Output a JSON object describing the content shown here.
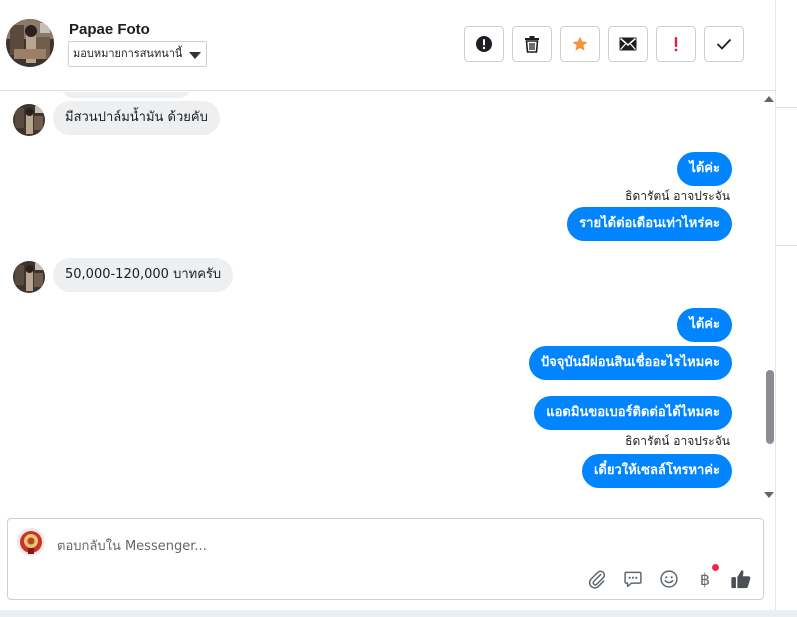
{
  "header": {
    "contact_name": "Papae Foto",
    "assign_label": "มอบหมายการสนทนานี้",
    "toolbar": [
      {
        "name": "report-button",
        "icon": "alert-circle-icon"
      },
      {
        "name": "delete-button",
        "icon": "trash-icon"
      },
      {
        "name": "star-button",
        "icon": "star-icon"
      },
      {
        "name": "mark-unread-button",
        "icon": "envelope-icon"
      },
      {
        "name": "flag-important-button",
        "icon": "exclamation-icon"
      },
      {
        "name": "mark-done-button",
        "icon": "checkmark-icon"
      }
    ]
  },
  "messages": [
    {
      "side": "in",
      "text": "มีสวนปาล์มน้ำมัน ด้วยคับ"
    },
    {
      "side": "out",
      "text": "ได้ค่ะ"
    },
    {
      "side": "sender",
      "text": "ธิดารัตน์ อาจประจัน"
    },
    {
      "side": "out",
      "text": "รายได้ต่อเดือนเท่าไหร่คะ"
    },
    {
      "side": "in",
      "text": "50,000-120,000 บาทครับ"
    },
    {
      "side": "out",
      "text": "ได้ค่ะ"
    },
    {
      "side": "out",
      "text": "ปัจจุบันมีผ่อนสินเชื่ออะไรไหมคะ"
    },
    {
      "side": "out",
      "text": "แอดมินขอเบอร์ติดต่อได้ไหมคะ"
    },
    {
      "side": "sender",
      "text": "ธิดารัตน์ อาจประจัน"
    },
    {
      "side": "out",
      "text": "เดี๋ยวให้เซลล์โทรหาค่ะ"
    }
  ],
  "composer": {
    "placeholder": "ตอบกลับใน Messenger...",
    "currency_symbol": "฿",
    "tools": [
      "paperclip-icon",
      "saved-reply-icon",
      "emoji-icon",
      "payment-icon",
      "thumbs-up-icon"
    ]
  },
  "colors": {
    "outgoing_bubble": "#0084ff",
    "incoming_bubble": "#eeeff1",
    "star": "#f7923b",
    "flag": "#e41e3f",
    "notification_dot": "#f02849"
  }
}
